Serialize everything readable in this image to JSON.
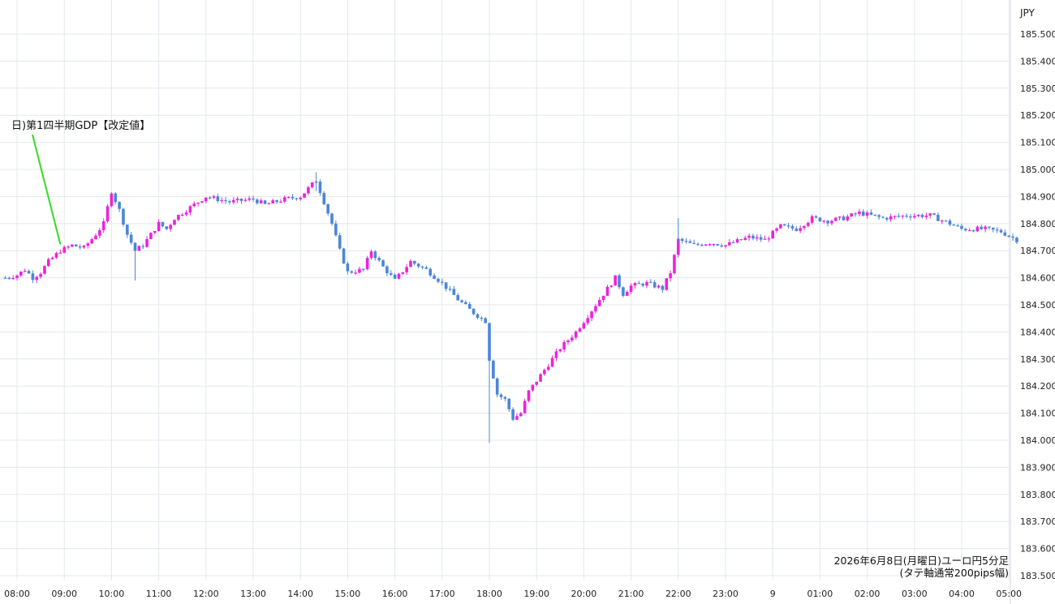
{
  "chart_data": {
    "type": "candlestick",
    "currency_label": "JPY",
    "caption_line1": "2026年6月8日(月曜日)ユーロ円5分足",
    "caption_line2": "(タテ軸通常200pips幅)",
    "annotation": "日)第1四半期GDP【改定値】",
    "ylim": [
      183.5,
      185.6
    ],
    "y_ticks": [
      "185.500",
      "185.400",
      "185.300",
      "185.200",
      "185.100",
      "185.000",
      "184.900",
      "184.800",
      "184.700",
      "184.600",
      "184.500",
      "184.400",
      "184.300",
      "184.200",
      "184.100",
      "184.000",
      "183.900",
      "183.800",
      "183.700",
      "183.600",
      "183.500"
    ],
    "x_ticks": [
      "08:00",
      "09:00",
      "10:00",
      "11:00",
      "12:00",
      "13:00",
      "14:00",
      "15:00",
      "16:00",
      "17:00",
      "18:00",
      "19:00",
      "20:00",
      "21:00",
      "22:00",
      "23:00",
      "9",
      "01:00",
      "02:00",
      "03:00",
      "04:00",
      "05:00"
    ],
    "annotation_time": "08:55",
    "colors": {
      "up": "#ee22dd",
      "down": "#4a86d8",
      "annotation_line": "#33dd22",
      "grid": "#e3e8ee"
    },
    "path_points": [
      [
        "07:45",
        184.6
      ],
      [
        "08:00",
        184.61
      ],
      [
        "08:10",
        184.63
      ],
      [
        "08:20",
        184.6
      ],
      [
        "08:30",
        184.62
      ],
      [
        "08:40",
        184.66
      ],
      [
        "08:55",
        184.7
      ],
      [
        "09:10",
        184.72
      ],
      [
        "09:25",
        184.71
      ],
      [
        "09:40",
        184.76
      ],
      [
        "09:50",
        184.8
      ],
      [
        "10:00",
        184.92
      ],
      [
        "10:10",
        184.85
      ],
      [
        "10:20",
        184.76
      ],
      [
        "10:30",
        184.7
      ],
      [
        "10:40",
        184.72
      ],
      [
        "10:50",
        184.76
      ],
      [
        "11:00",
        184.8
      ],
      [
        "11:10",
        184.78
      ],
      [
        "11:20",
        184.82
      ],
      [
        "11:40",
        184.86
      ],
      [
        "12:00",
        184.9
      ],
      [
        "12:30",
        184.88
      ],
      [
        "13:00",
        184.89
      ],
      [
        "13:15",
        184.87
      ],
      [
        "13:40",
        184.89
      ],
      [
        "14:00",
        184.9
      ],
      [
        "14:20",
        184.96
      ],
      [
        "14:30",
        184.88
      ],
      [
        "14:40",
        184.8
      ],
      [
        "14:50",
        184.7
      ],
      [
        "15:00",
        184.62
      ],
      [
        "15:20",
        184.63
      ],
      [
        "15:30",
        184.7
      ],
      [
        "15:45",
        184.64
      ],
      [
        "16:00",
        184.59
      ],
      [
        "16:20",
        184.66
      ],
      [
        "16:40",
        184.63
      ],
      [
        "17:00",
        184.58
      ],
      [
        "17:20",
        184.52
      ],
      [
        "17:40",
        184.47
      ],
      [
        "17:55",
        184.44
      ],
      [
        "18:00",
        184.3
      ],
      [
        "18:10",
        184.17
      ],
      [
        "18:20",
        184.15
      ],
      [
        "18:30",
        184.08
      ],
      [
        "18:40",
        184.1
      ],
      [
        "18:50",
        184.18
      ],
      [
        "19:10",
        184.26
      ],
      [
        "19:30",
        184.34
      ],
      [
        "19:50",
        184.4
      ],
      [
        "20:00",
        184.44
      ],
      [
        "20:20",
        184.52
      ],
      [
        "20:40",
        184.6
      ],
      [
        "20:50",
        184.54
      ],
      [
        "21:00",
        184.57
      ],
      [
        "21:20",
        184.58
      ],
      [
        "21:40",
        184.56
      ],
      [
        "21:50",
        184.62
      ],
      [
        "22:00",
        184.74
      ],
      [
        "22:20",
        184.72
      ],
      [
        "22:40",
        184.73
      ],
      [
        "23:00",
        184.72
      ],
      [
        "23:30",
        184.75
      ],
      [
        "23:50",
        184.74
      ],
      [
        "00:10",
        184.79
      ],
      [
        "00:30",
        184.78
      ],
      [
        "00:50",
        184.82
      ],
      [
        "01:10",
        184.81
      ],
      [
        "01:30",
        184.82
      ],
      [
        "01:50",
        184.84
      ],
      [
        "02:20",
        184.82
      ],
      [
        "02:50",
        184.83
      ],
      [
        "03:20",
        184.83
      ],
      [
        "03:45",
        184.8
      ],
      [
        "04:00",
        184.78
      ],
      [
        "04:30",
        184.78
      ],
      [
        "04:50",
        184.77
      ],
      [
        "05:10",
        184.74
      ]
    ]
  }
}
